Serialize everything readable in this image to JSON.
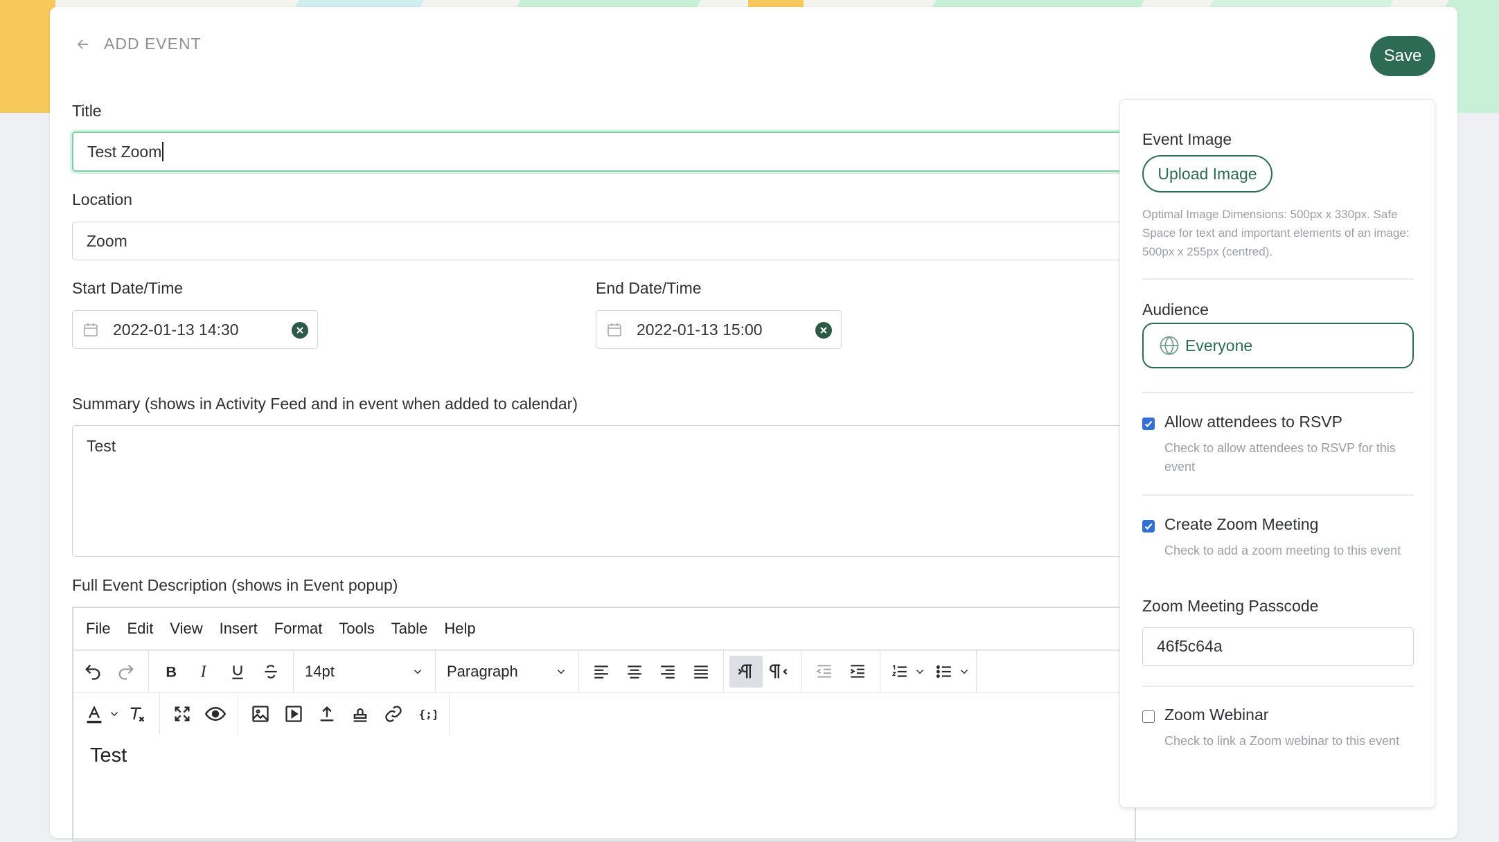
{
  "header": {
    "back_label": "ADD EVENT",
    "save_label": "Save"
  },
  "form": {
    "title_label": "Title",
    "title_value": "Test Zoom",
    "location_label": "Location",
    "location_value": "Zoom",
    "start_label": "Start Date/Time",
    "start_value": "2022-01-13 14:30",
    "end_label": "End Date/Time",
    "end_value": "2022-01-13 15:00",
    "summary_label": "Summary (shows in Activity Feed and in event when added to calendar)",
    "summary_value": "Test",
    "description_label": "Full Event Description (shows in Event popup)"
  },
  "editor": {
    "menus": [
      "File",
      "Edit",
      "View",
      "Insert",
      "Format",
      "Tools",
      "Table",
      "Help"
    ],
    "font_size": "14pt",
    "block_format": "Paragraph",
    "content": "Test"
  },
  "sidebar": {
    "image_heading": "Event Image",
    "upload_label": "Upload Image",
    "image_hint": "Optimal Image Dimensions: 500px x 330px. Safe Space for text and important elements of an image: 500px x 255px (centred).",
    "audience_heading": "Audience",
    "audience_value": "Everyone",
    "rsvp_label": "Allow attendees to RSVP",
    "rsvp_hint": "Check to allow attendees to RSVP for this event",
    "rsvp_checked": true,
    "zoom_label": "Create Zoom Meeting",
    "zoom_hint": "Check to add a zoom meeting to this event",
    "zoom_checked": true,
    "passcode_label": "Zoom Meeting Passcode",
    "passcode_value": "46f5c64a",
    "webinar_label": "Zoom Webinar",
    "webinar_hint": "Check to link a Zoom webinar to this event",
    "webinar_checked": false
  },
  "colors": {
    "accent": "#2e6b54",
    "checkbox": "#2f6fd6",
    "focus_border": "#7fcfa6"
  }
}
